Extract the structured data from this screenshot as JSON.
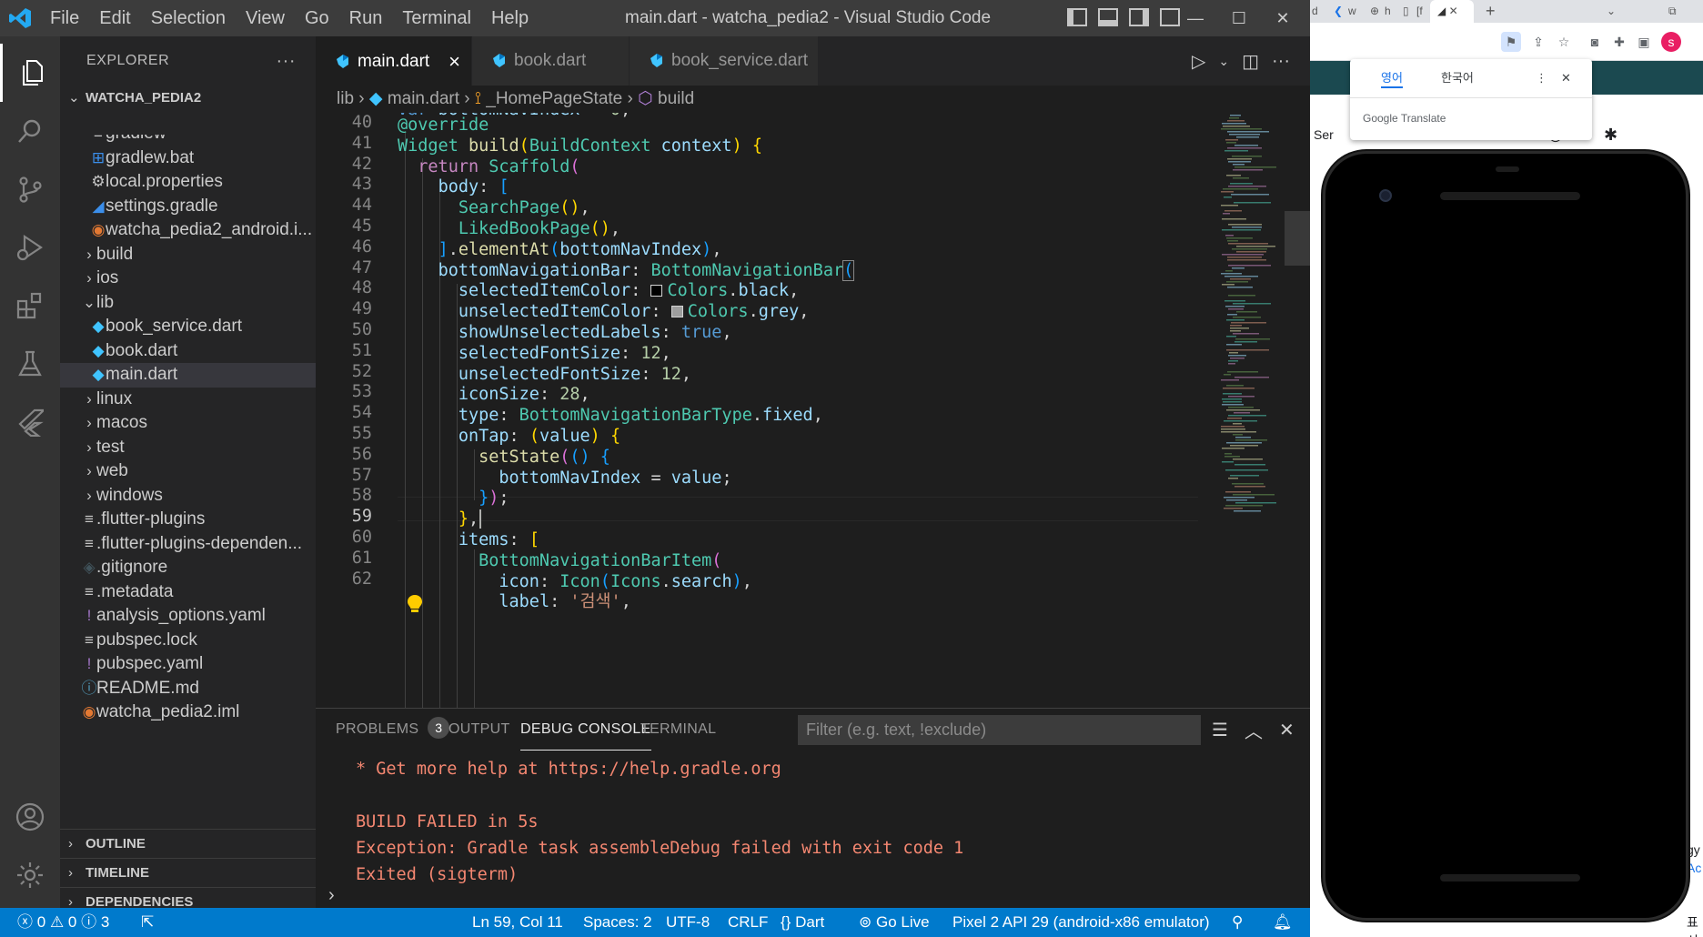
{
  "titlebar": {
    "menu": [
      "File",
      "Edit",
      "Selection",
      "View",
      "Go",
      "Run",
      "Terminal",
      "Help"
    ],
    "title": "main.dart - watcha_pedia2 - Visual Studio Code",
    "controls": [
      "—",
      "☐",
      "✕"
    ]
  },
  "sidebar": {
    "title": "EXPLORER",
    "more": "···",
    "project": "WATCHA_PEDIA2",
    "tree": [
      {
        "label": "gradlew",
        "icon": "file-lines-icon",
        "depth": 2
      },
      {
        "label": "gradlew.bat",
        "icon": "windows-icon",
        "depth": 2
      },
      {
        "label": "local.properties",
        "icon": "gear-icon",
        "depth": 2
      },
      {
        "label": "settings.gradle",
        "icon": "gradle-elephant-icon",
        "depth": 2
      },
      {
        "label": "watcha_pedia2_android.i...",
        "icon": "rss-icon",
        "depth": 2
      },
      {
        "label": "build",
        "icon": "chevron-right-icon",
        "depth": 1
      },
      {
        "label": "ios",
        "icon": "chevron-right-icon",
        "depth": 1
      },
      {
        "label": "lib",
        "icon": "chevron-down-icon",
        "depth": 1
      },
      {
        "label": "book_service.dart",
        "icon": "dart-icon",
        "depth": 2
      },
      {
        "label": "book.dart",
        "icon": "dart-icon",
        "depth": 2
      },
      {
        "label": "main.dart",
        "icon": "dart-icon",
        "depth": 2,
        "selected": true
      },
      {
        "label": "linux",
        "icon": "chevron-right-icon",
        "depth": 1
      },
      {
        "label": "macos",
        "icon": "chevron-right-icon",
        "depth": 1
      },
      {
        "label": "test",
        "icon": "chevron-right-icon",
        "depth": 1
      },
      {
        "label": "web",
        "icon": "chevron-right-icon",
        "depth": 1
      },
      {
        "label": "windows",
        "icon": "chevron-right-icon",
        "depth": 1
      },
      {
        "label": ".flutter-plugins",
        "icon": "file-lines-icon",
        "depth": 1
      },
      {
        "label": ".flutter-plugins-dependen...",
        "icon": "file-lines-icon",
        "depth": 1
      },
      {
        "label": ".gitignore",
        "icon": "git-icon",
        "depth": 1
      },
      {
        "label": ".metadata",
        "icon": "file-lines-icon",
        "depth": 1
      },
      {
        "label": "analysis_options.yaml",
        "icon": "yaml-icon",
        "depth": 1
      },
      {
        "label": "pubspec.lock",
        "icon": "file-lines-icon",
        "depth": 1
      },
      {
        "label": "pubspec.yaml",
        "icon": "yaml-icon",
        "depth": 1
      },
      {
        "label": "README.md",
        "icon": "info-icon",
        "depth": 1
      },
      {
        "label": "watcha_pedia2.iml",
        "icon": "rss-icon",
        "depth": 1
      }
    ],
    "sections": [
      "OUTLINE",
      "TIMELINE",
      "DEPENDENCIES"
    ]
  },
  "tabs": [
    {
      "label": "main.dart",
      "active": true
    },
    {
      "label": "book.dart",
      "active": false
    },
    {
      "label": "book_service.dart",
      "active": false
    }
  ],
  "breadcrumb": [
    "lib",
    "main.dart",
    "_HomePageState",
    "build"
  ],
  "editor": {
    "line_numbers": [
      "40",
      "41",
      "42",
      "43",
      "44",
      "45",
      "46",
      "47",
      "48",
      "49",
      "50",
      "51",
      "52",
      "53",
      "54",
      "55",
      "56",
      "57",
      "58",
      "59",
      "60",
      "61",
      "62"
    ],
    "current_line": "59"
  },
  "panel": {
    "tabs": [
      "PROBLEMS",
      "OUTPUT",
      "DEBUG CONSOLE",
      "TERMINAL"
    ],
    "problems_count": "3",
    "active_tab": "DEBUG CONSOLE",
    "filter_placeholder": "Filter (e.g. text, !exclude)",
    "console_lines": [
      "* Get more help at https://help.gradle.org",
      "",
      "BUILD FAILED in 5s",
      "Exception: Gradle task assembleDebug failed with exit code 1",
      "Exited (sigterm)"
    ]
  },
  "statusbar": {
    "errors": "0",
    "warnings": "0",
    "info": "3",
    "position": "Ln 59, Col 11",
    "spaces": "Spaces: 2",
    "encoding": "UTF-8",
    "eol": "CRLF",
    "language": "Dart",
    "golive": "Go Live",
    "device": "Pixel 2 API 29 (android-x86 emulator)"
  },
  "chrome": {
    "tabs": [
      "d",
      "w",
      "h",
      "[f",
      "✕"
    ],
    "translate": {
      "lang_from": "영어",
      "lang_to": "한국어",
      "brand": "Google Translate"
    },
    "page_text_left": "Ser",
    "page_text_right": [
      "gy",
      "Ac",
      "표시"
    ]
  },
  "colors": {
    "accent": "#007acc",
    "error_text": "#f48771",
    "page_header": "#1b4950"
  }
}
